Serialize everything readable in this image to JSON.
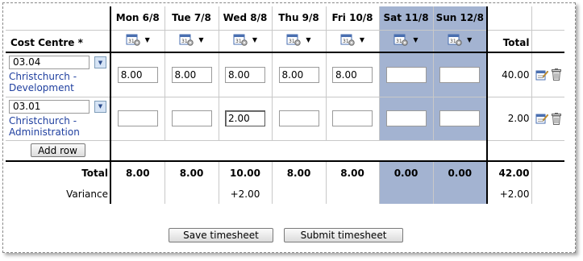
{
  "header": {
    "cost_centre_label": "Cost Centre *",
    "total_label": "Total",
    "days": [
      {
        "label": "Mon 6/8",
        "weekend": false
      },
      {
        "label": "Tue 7/8",
        "weekend": false
      },
      {
        "label": "Wed 8/8",
        "weekend": false
      },
      {
        "label": "Thu 9/8",
        "weekend": false
      },
      {
        "label": "Fri 10/8",
        "weekend": false
      },
      {
        "label": "Sat 11/8",
        "weekend": true
      },
      {
        "label": "Sun 12/8",
        "weekend": true
      }
    ]
  },
  "rows": [
    {
      "cost_centre_code": "03.04",
      "cost_centre_name": "Christchurch - Development",
      "hours": [
        "8.00",
        "8.00",
        "8.00",
        "8.00",
        "8.00",
        "",
        ""
      ],
      "total": "40.00"
    },
    {
      "cost_centre_code": "03.01",
      "cost_centre_name": "Christchurch - Administration",
      "hours": [
        "",
        "",
        "2.00",
        "",
        "",
        "",
        ""
      ],
      "total": "2.00"
    }
  ],
  "add_row_label": "Add row",
  "totals": {
    "label": "Total",
    "values": [
      "8.00",
      "8.00",
      "10.00",
      "8.00",
      "8.00",
      "0.00",
      "0.00"
    ],
    "grand_total": "42.00"
  },
  "variance": {
    "label": "Variance",
    "values": [
      "",
      "",
      "+2.00",
      "",
      "",
      "",
      ""
    ],
    "total": "+2.00"
  },
  "buttons": {
    "save": "Save timesheet",
    "submit": "Submit timesheet"
  },
  "colors": {
    "weekend_bg": "#a3b3d1",
    "link": "#1f3f9f"
  },
  "icons": {
    "calendar": "calendar-settings-icon",
    "edit": "edit-note-icon",
    "delete": "trash-icon"
  }
}
